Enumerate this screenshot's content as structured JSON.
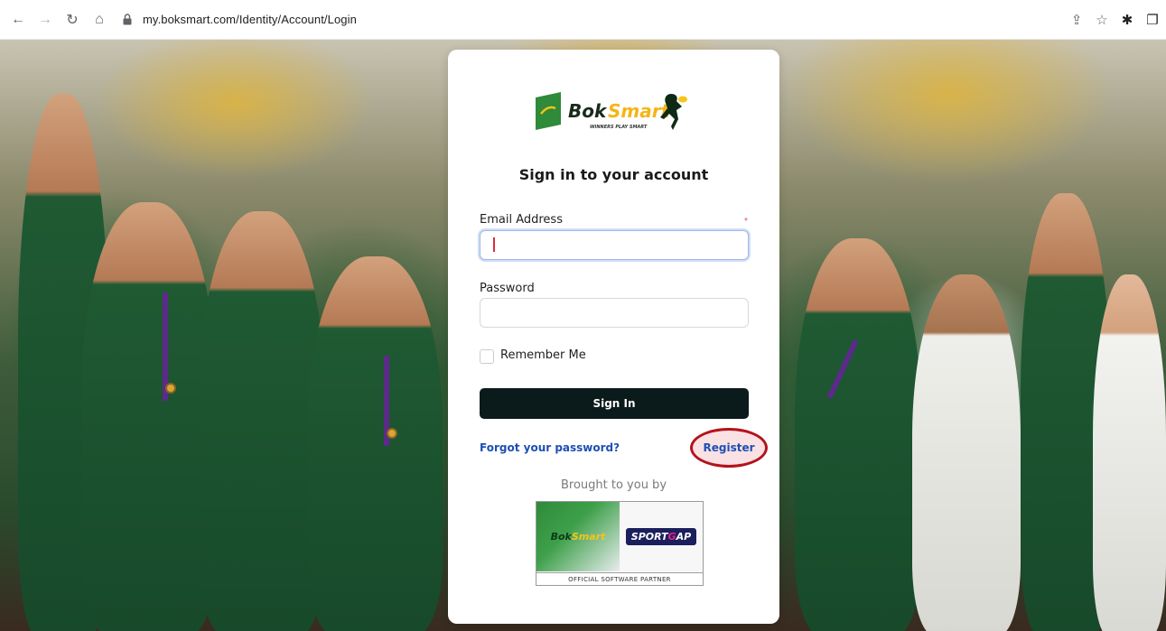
{
  "browser": {
    "url": "my.boksmart.com/Identity/Account/Login",
    "nav_back": "←",
    "nav_forward": "→",
    "nav_reload": "↻",
    "nav_home": "⌂",
    "share_icon": "⇪",
    "star_icon": "☆",
    "extensions_icon": "✱",
    "sidebar_icon": "❐"
  },
  "login": {
    "logo_text_bok": "Bok",
    "logo_text_smart": "Smart",
    "logo_tagline": "WINNERS PLAY SMART",
    "title": "Sign in to your account",
    "email_label": "Email Address",
    "email_required_mark": "*",
    "email_value": "",
    "password_label": "Password",
    "password_value": "",
    "remember_label": "Remember Me",
    "signin_label": "Sign In",
    "forgot_label": "Forgot your password?",
    "register_label": "Register",
    "brought_by": "Brought to you by"
  },
  "partner": {
    "boksmart_bok": "Bok",
    "boksmart_smart": "Smart",
    "sportgap_pre": "SPORT",
    "sportgap_g": "G",
    "sportgap_post": "AP",
    "caption": "OFFICIAL SOFTWARE PARTNER"
  },
  "colors": {
    "accent_green": "#2f8a3a",
    "button_dark": "#0b1a1a",
    "link_blue": "#1e4fb4",
    "highlight_red": "#b5121b"
  }
}
